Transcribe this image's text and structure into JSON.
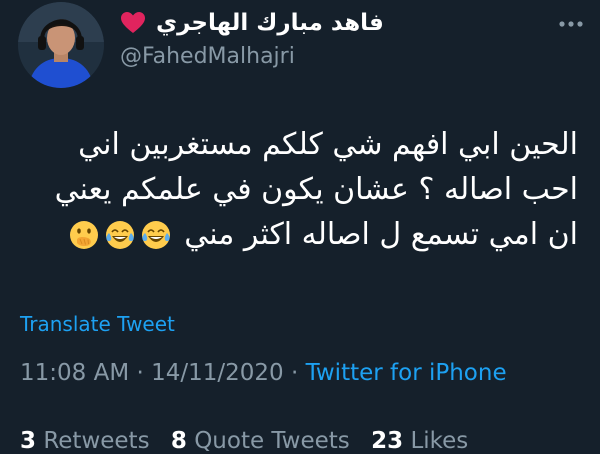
{
  "user": {
    "display_name": "فاهد مبارك الهاجري",
    "handle": "@FahedMalhajri",
    "avatar_icon": "profile-photo"
  },
  "tweet": {
    "lines": [
      "الحين ابي افهم شي كلكم مستغربين اني",
      "احب اصاله ؟ عشان يكون في علمكم يعني",
      "ان امي تسمع ل اصاله اكثر مني"
    ],
    "emojis": [
      "face-with-tears-of-joy",
      "face-with-tears-of-joy",
      "face-with-hand-over-mouth"
    ]
  },
  "translate_label": "Translate Tweet",
  "meta": {
    "time": "11:08 AM",
    "separator": " · ",
    "date": "14/11/2020",
    "source": "Twitter for iPhone"
  },
  "stats": {
    "retweets_count": "3",
    "retweets_label": "Retweets",
    "quotes_count": "8",
    "quotes_label": "Quote Tweets",
    "likes_count": "23",
    "likes_label": "Likes"
  },
  "colors": {
    "background": "#15202b",
    "accent": "#1da1f2",
    "secondary_text": "#8899a6",
    "heart": "#e0245e"
  }
}
